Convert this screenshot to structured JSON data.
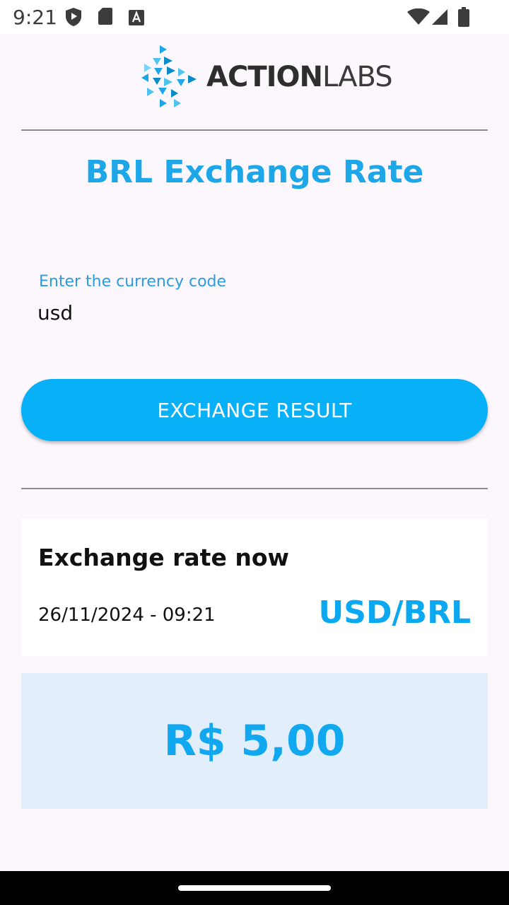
{
  "status_bar": {
    "time": "9:21",
    "left_icons": [
      "play-shield-icon",
      "sd-card-icon",
      "font-a-icon"
    ],
    "right_icons": [
      "wifi-icon",
      "cell-signal-icon",
      "battery-icon"
    ]
  },
  "logo": {
    "bold_text": "ACTION",
    "light_text": "LABS",
    "brand_color": "#1EA7E8"
  },
  "title": "BRL Exchange Rate",
  "currency_field": {
    "label": "Enter the currency code",
    "value": "usd"
  },
  "exchange_button": {
    "label": "EXCHANGE RESULT"
  },
  "rate_card": {
    "title": "Exchange rate now",
    "datetime": "26/11/2024 - 09:21",
    "pair": "USD/BRL"
  },
  "result": {
    "value": "R$ 5,00"
  },
  "colors": {
    "accent": "#08B0F8",
    "title": "#1EA7E8",
    "result_bg": "#E3EEFB",
    "page_bg": "#FCF7FC"
  }
}
